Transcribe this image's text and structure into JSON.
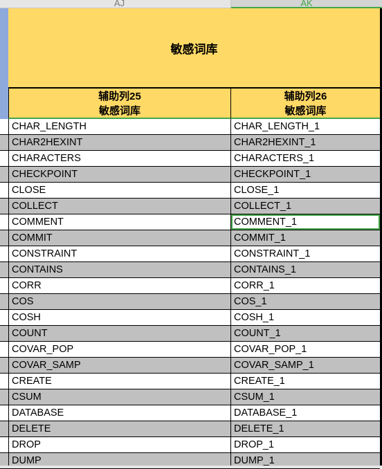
{
  "column_headers": [
    "AJ",
    "AK"
  ],
  "selected_column": "AK",
  "title": "敏感词库",
  "subheaders": [
    {
      "line1": "辅助列25",
      "line2": "敏感词库"
    },
    {
      "line1": "辅助列26",
      "line2": "敏感词库"
    }
  ],
  "selected_cell": {
    "row_index": 6,
    "column": "AK"
  },
  "colors": {
    "header_fill": "#ffd966",
    "alt_row_fill": "#c0c0c0",
    "selection": "#44a548",
    "row_header_selected": "#8eaadc"
  },
  "rows": [
    [
      "CHAR_LENGTH",
      "CHAR_LENGTH_1"
    ],
    [
      "CHAR2HEXINT",
      "CHAR2HEXINT_1"
    ],
    [
      "CHARACTERS",
      "CHARACTERS_1"
    ],
    [
      "CHECKPOINT",
      "CHECKPOINT_1"
    ],
    [
      "CLOSE",
      "CLOSE_1"
    ],
    [
      "COLLECT",
      "COLLECT_1"
    ],
    [
      "COMMENT",
      "COMMENT_1"
    ],
    [
      "COMMIT",
      "COMMIT_1"
    ],
    [
      "CONSTRAINT",
      "CONSTRAINT_1"
    ],
    [
      "CONTAINS",
      "CONTAINS_1"
    ],
    [
      "CORR",
      "CORR_1"
    ],
    [
      "COS",
      "COS_1"
    ],
    [
      "COSH",
      "COSH_1"
    ],
    [
      "COUNT",
      "COUNT_1"
    ],
    [
      "COVAR_POP",
      "COVAR_POP_1"
    ],
    [
      "COVAR_SAMP",
      "COVAR_SAMP_1"
    ],
    [
      "CREATE",
      "CREATE_1"
    ],
    [
      "CSUM",
      "CSUM_1"
    ],
    [
      "DATABASE",
      "DATABASE_1"
    ],
    [
      "DELETE",
      "DELETE_1"
    ],
    [
      "DROP",
      "DROP_1"
    ],
    [
      "DUMP",
      "DUMP_1"
    ]
  ]
}
